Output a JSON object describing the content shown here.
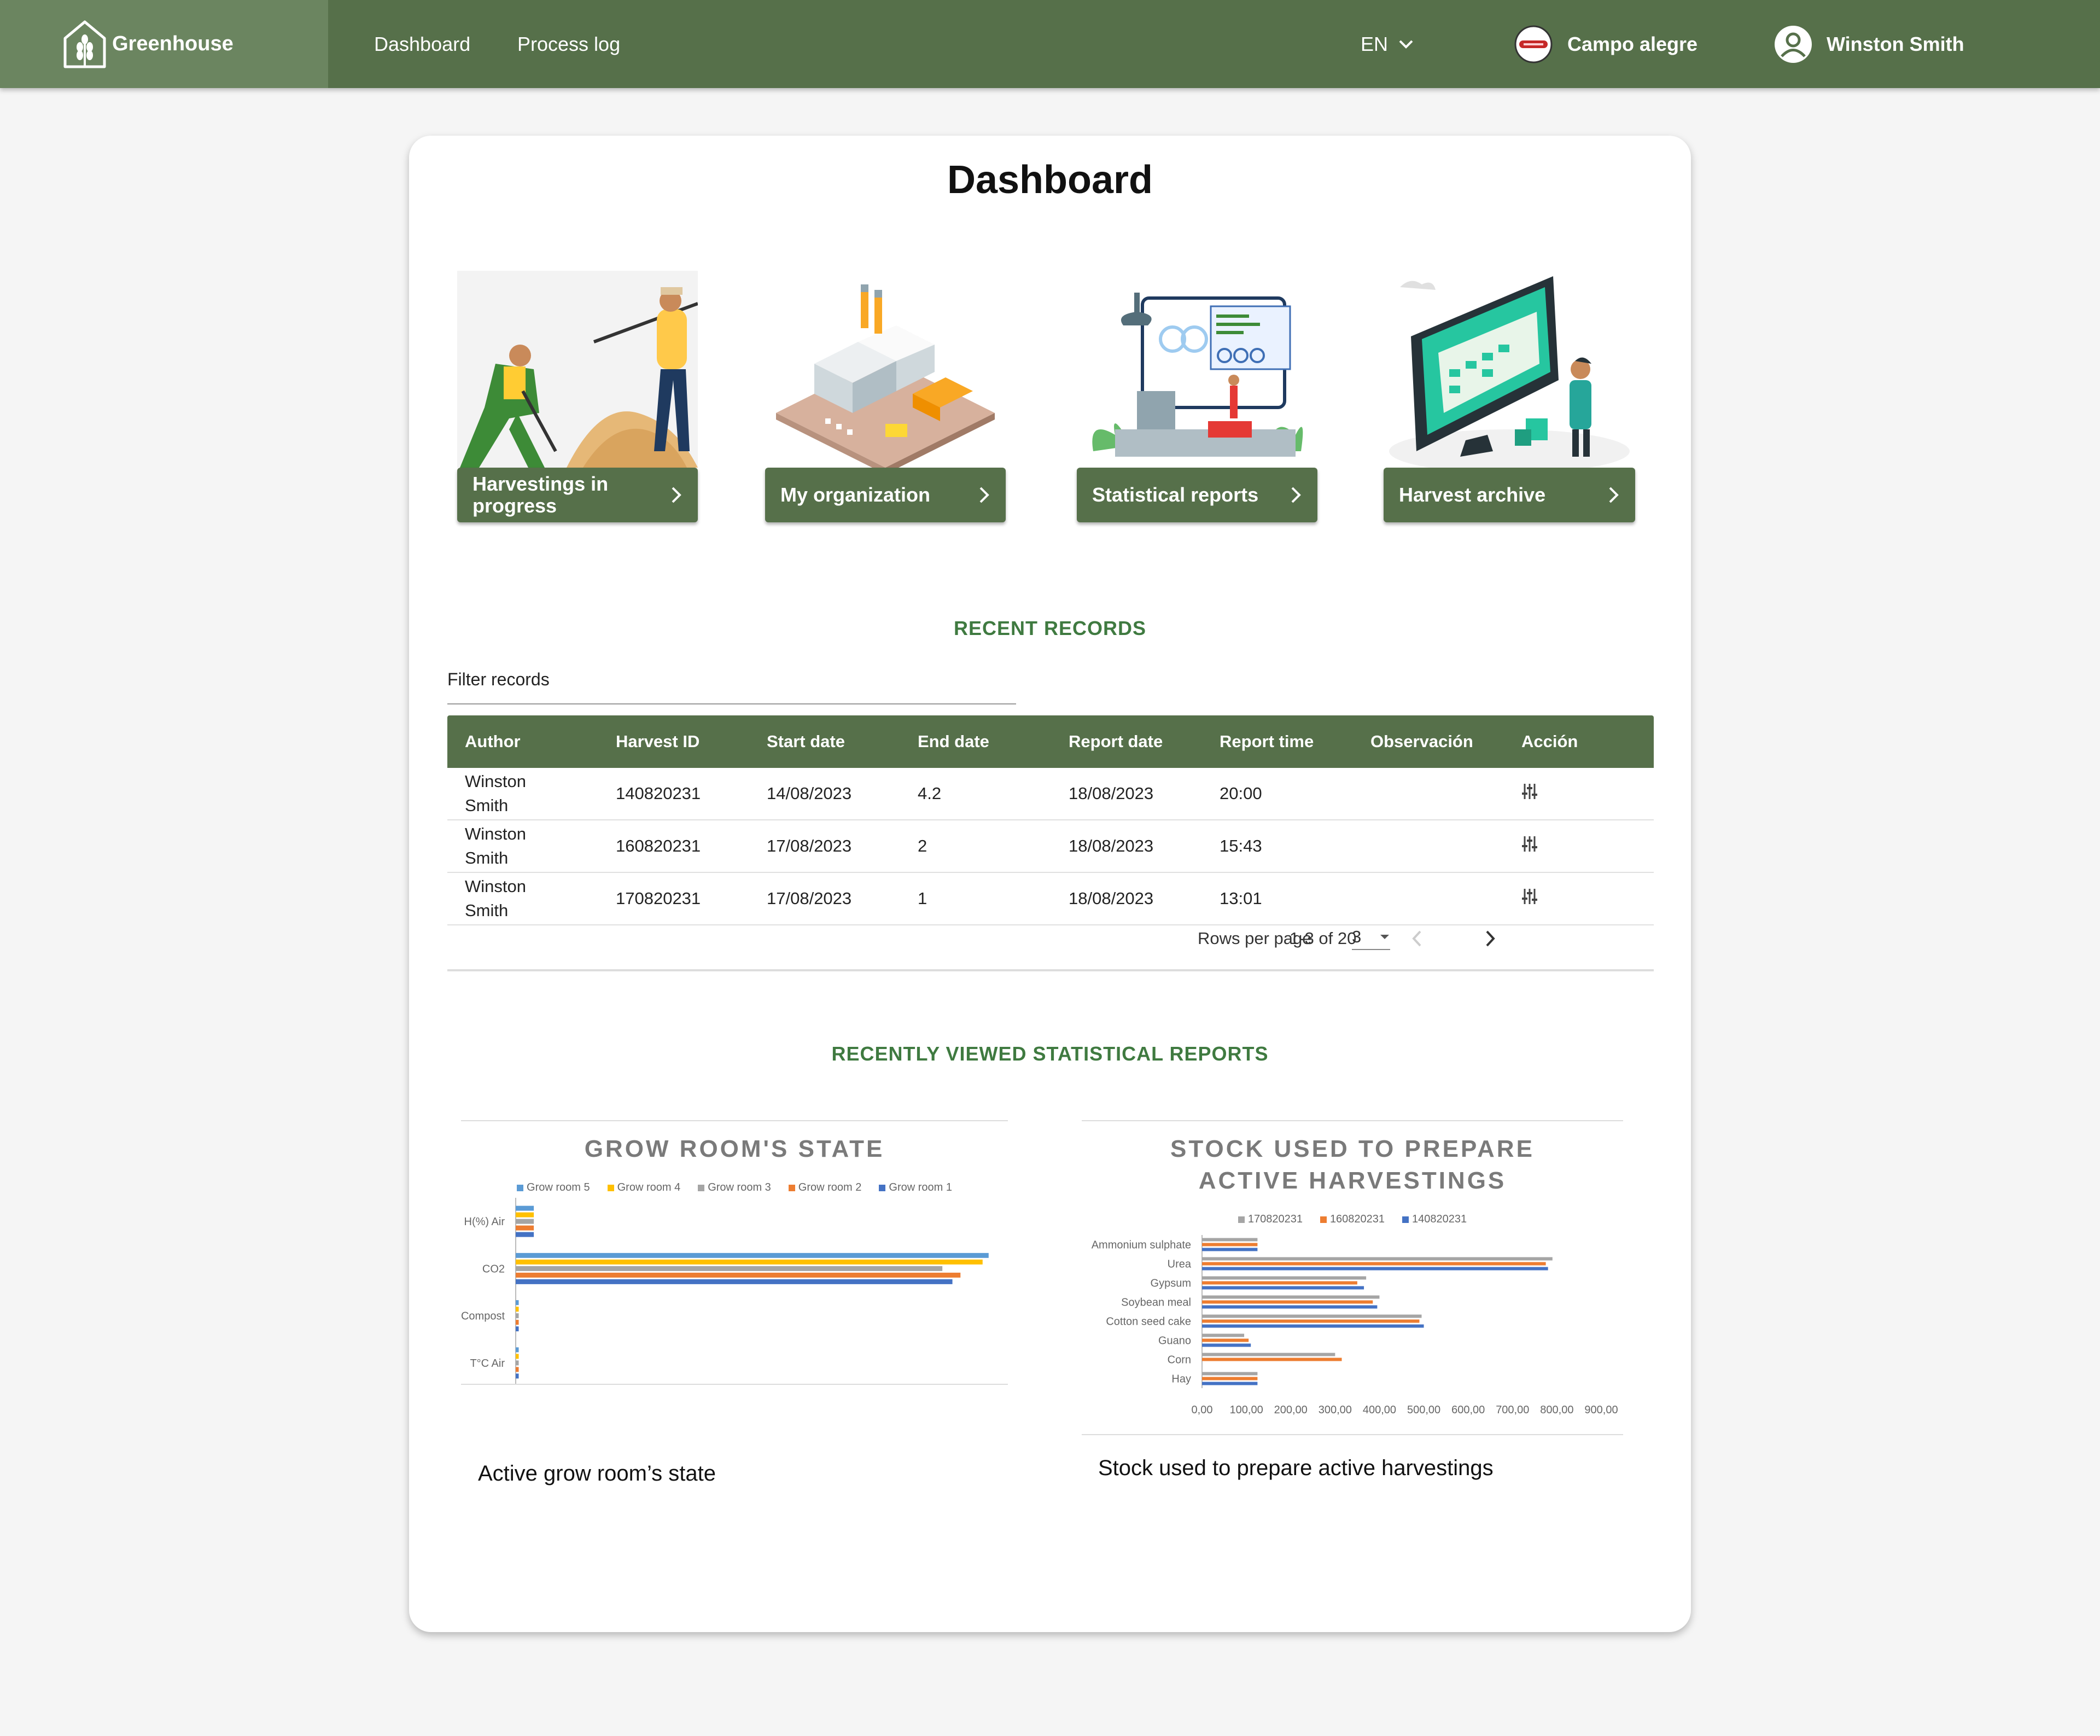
{
  "header": {
    "brand": "Greenhouse",
    "nav": [
      "Dashboard",
      "Process log"
    ],
    "language": "EN",
    "organization": "Campo alegre",
    "user": "Winston Smith"
  },
  "page": {
    "title": "Dashboard"
  },
  "tiles": [
    {
      "label": "Harvestings in progress"
    },
    {
      "label": "My organization"
    },
    {
      "label": "Statistical reports"
    },
    {
      "label": "Harvest archive"
    }
  ],
  "records": {
    "section_title": "RECENT RECORDS",
    "filter_label": "Filter records",
    "columns": [
      "Author",
      "Harvest ID",
      "Start date",
      "End date",
      "Report date",
      "Report time",
      "Observación",
      "Acción"
    ],
    "rows": [
      {
        "author": "Winston Smith",
        "harvest_id": "140820231",
        "start": "14/08/2023",
        "end": "4.2",
        "report_date": "18/08/2023",
        "report_time": "20:00",
        "obs": ""
      },
      {
        "author": "Winston Smith",
        "harvest_id": "160820231",
        "start": "17/08/2023",
        "end": "2",
        "report_date": "18/08/2023",
        "report_time": "15:43",
        "obs": ""
      },
      {
        "author": "Winston Smith",
        "harvest_id": "170820231",
        "start": "17/08/2023",
        "end": "1",
        "report_date": "18/08/2023",
        "report_time": "13:01",
        "obs": ""
      }
    ],
    "pagination": {
      "rows_per_page_label": "Rows per page",
      "rows_per_page": "3",
      "range": "1-3 of 20"
    }
  },
  "reports": {
    "section_title": "RECENTLY VIEWED STATISTICAL REPORTS",
    "captions": [
      "Active grow room’s state",
      "Stock used to prepare active harvestings"
    ]
  },
  "chart_data": [
    {
      "type": "bar",
      "orientation": "horizontal",
      "title": "GROW ROOM'S STATE",
      "categories": [
        "H(%) Air",
        "CO2",
        "Compost",
        "T°C Air"
      ],
      "series": [
        {
          "name": "Grow room 5",
          "color": "#5b9bd5",
          "values": [
            90,
            2350,
            15,
            15
          ]
        },
        {
          "name": "Grow room 4",
          "color": "#ffc000",
          "values": [
            90,
            2320,
            15,
            15
          ]
        },
        {
          "name": "Grow room 3",
          "color": "#a5a5a5",
          "values": [
            90,
            2120,
            15,
            15
          ]
        },
        {
          "name": "Grow room 2",
          "color": "#ed7d31",
          "values": [
            90,
            2210,
            15,
            15
          ]
        },
        {
          "name": "Grow room 1",
          "color": "#4472c4",
          "values": [
            90,
            2170,
            15,
            15
          ]
        }
      ],
      "xticks": [
        "0",
        "500",
        "1000",
        "1500",
        "2000",
        "2"
      ],
      "xlim": [
        0,
        2500
      ]
    },
    {
      "type": "bar",
      "orientation": "horizontal",
      "title": "STOCK USED TO PREPARE ACTIVE HARVESTINGS",
      "categories": [
        "Ammonium sulphate",
        "Urea",
        "Gypsum",
        "Soybean meal",
        "Cotton seed cake",
        "Guano",
        "Corn",
        "Hay"
      ],
      "series": [
        {
          "name": "170820231",
          "color": "#a5a5a5",
          "values": [
            125,
            790,
            370,
            400,
            495,
            95,
            300,
            125
          ]
        },
        {
          "name": "160820231",
          "color": "#ed7d31",
          "values": [
            125,
            775,
            350,
            385,
            490,
            105,
            315,
            125
          ]
        },
        {
          "name": "140820231",
          "color": "#4472c4",
          "values": [
            125,
            780,
            365,
            395,
            500,
            110,
            0,
            125
          ]
        }
      ],
      "xticks": [
        "0,00",
        "100,00",
        "200,00",
        "300,00",
        "400,00",
        "500,00",
        "600,00",
        "700,00",
        "800,00",
        "900,00"
      ],
      "xlim": [
        0,
        900
      ]
    }
  ]
}
